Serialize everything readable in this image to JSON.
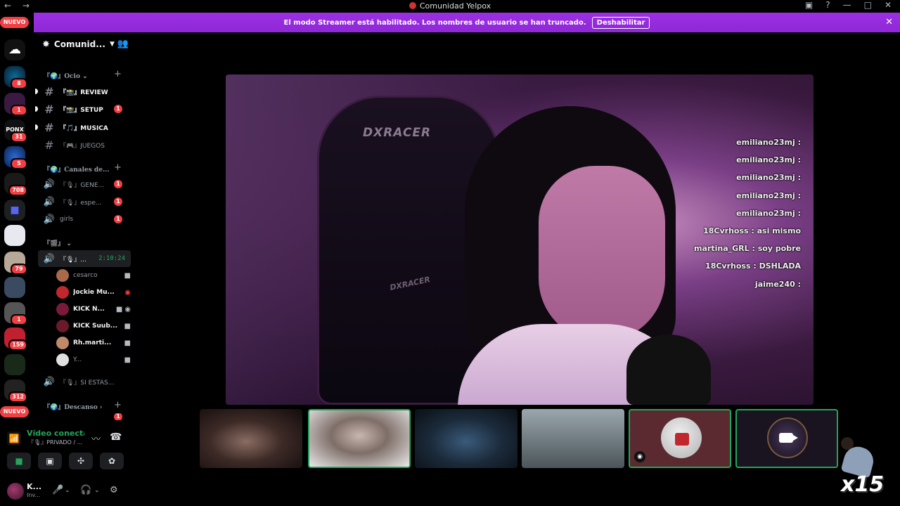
{
  "window": {
    "title": "Comunidad Yelpox",
    "controls": [
      "—",
      "□",
      "✕"
    ]
  },
  "banner": {
    "message": "El modo Streamer está habilitado. Los nombres de usuario se han truncado.",
    "disable_label": "Deshabilitar"
  },
  "rail": {
    "nuevo_label": "NUEVO",
    "badges": [
      "8",
      "1",
      "31",
      "5",
      "708",
      "79",
      "1",
      "159",
      "312",
      "1"
    ]
  },
  "server": {
    "name": "Comunid..."
  },
  "categories": {
    "ocio": "『🌍』Ocio",
    "canales": "『🌍』Canales de...",
    "voz": "『🎬』",
    "descanso": "『🌍』Descanso"
  },
  "channels": [
    {
      "name": "『📸』REVIEW"
    },
    {
      "name": "『📸』SETUP",
      "badge": "1"
    },
    {
      "name": "『🎵』MUSICA"
    },
    {
      "name": "『🎮』JUEGOS"
    }
  ],
  "voice_channels": [
    {
      "name": "『🎙』GENE...",
      "badge": "1"
    },
    {
      "name": "『🎙』espe...",
      "badge": "1"
    },
    {
      "name": "girls",
      "badge": "1"
    }
  ],
  "active_voice": {
    "name": "『🎙』...",
    "time": "2:10:24"
  },
  "members": [
    "cesarco",
    "Jockie Mu...",
    "KICK N...",
    "KICK Suub...",
    "Rh.marti...",
    "Y..."
  ],
  "extra_channel": "『🎙』SI ESTAS...",
  "descanso_badge": "1",
  "voice_panel": {
    "title": "Vídeo conectado",
    "subtitle": "『🎙』PRIVADO / ..."
  },
  "user_panel": {
    "name": "K...",
    "status": "Inv..."
  },
  "stream_chat": [
    {
      "text": "emiliano23mj :"
    },
    {
      "text": "emiliano23mj :"
    },
    {
      "text": "emiliano23mj :"
    },
    {
      "text": "emiliano23mj :"
    },
    {
      "text": "emiliano23mj :"
    },
    {
      "text": "18Cvrhoss : asi mismo"
    },
    {
      "text": "martina_GRL : soy pobre"
    },
    {
      "text": "18Cvrhoss : DSHLADA"
    },
    {
      "text": "jaime240 :"
    }
  ],
  "stage": {
    "brand": "DXRACER"
  },
  "overlay": {
    "count": "x15"
  },
  "colors": {
    "banner": "#8f28d6",
    "green": "#23a55a",
    "badge": "#f23f43"
  }
}
